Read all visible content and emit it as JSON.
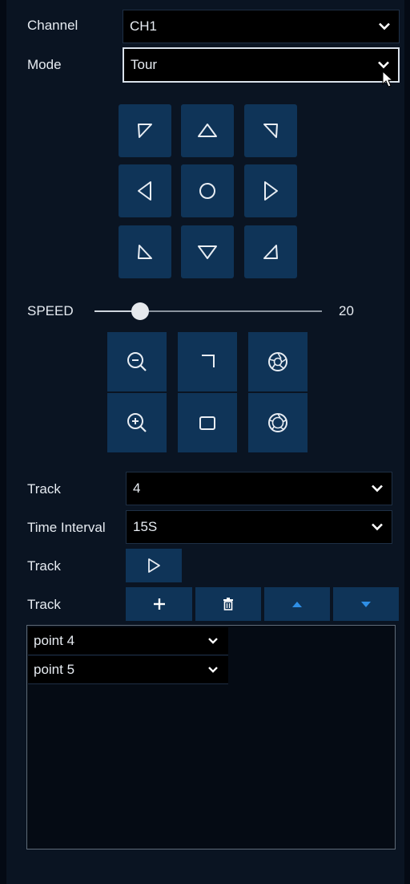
{
  "form": {
    "channel_label": "Channel",
    "channel_value": "CH1",
    "mode_label": "Mode",
    "mode_value": "Tour"
  },
  "ptz": {
    "directions": [
      "up-left",
      "up",
      "up-right",
      "left",
      "center",
      "right",
      "down-left",
      "down",
      "down-right"
    ]
  },
  "speed": {
    "label": "SPEED",
    "value": "20",
    "fraction": 0.2
  },
  "lens": {
    "buttons": [
      "zoom-out",
      "focus-near",
      "iris-close",
      "zoom-in",
      "focus-far",
      "iris-open"
    ]
  },
  "track": {
    "track_label": "Track",
    "track_value": "4",
    "interval_label": "Time Interval",
    "interval_value": "15S",
    "play_label": "Track",
    "edit_label": "Track",
    "points": [
      "point 4",
      "point 5"
    ]
  },
  "colors": {
    "button_bg": "#0f3458",
    "panel_bg": "#0a1422",
    "accent_arrow": "#2f8fe6"
  }
}
